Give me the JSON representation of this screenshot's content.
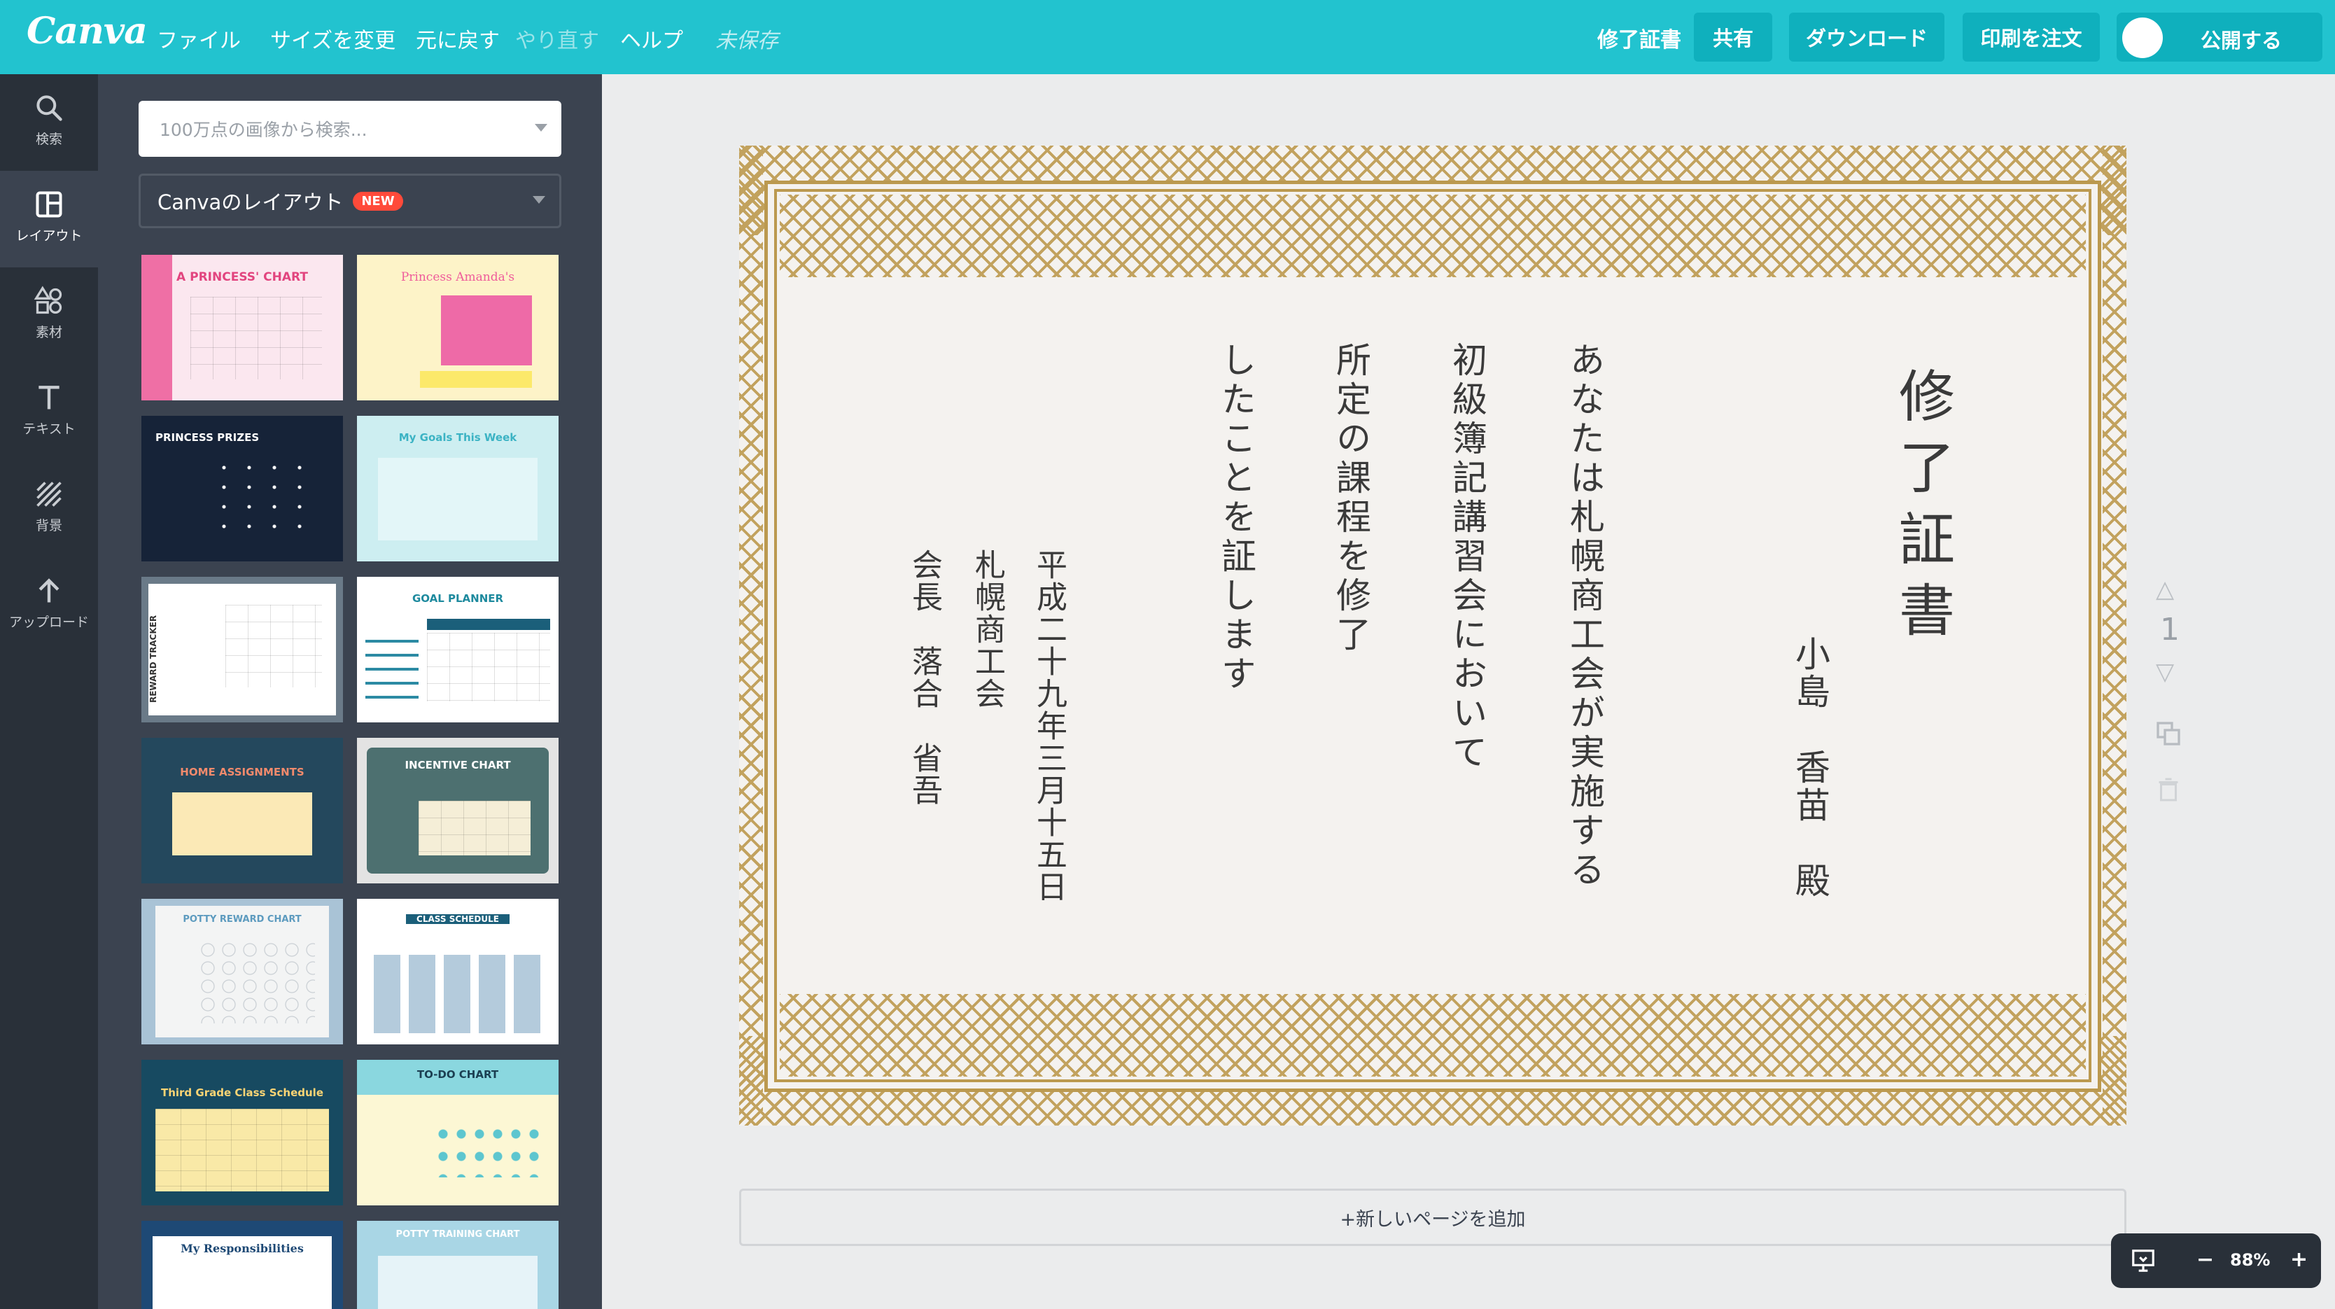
{
  "app": {
    "logo": "Canva"
  },
  "menu": {
    "file": "ファイル",
    "resize": "サイズを変更",
    "undo": "元に戻す",
    "redo": "やり直す",
    "help": "ヘルプ",
    "status": "未保存"
  },
  "toolbar": {
    "doc_title": "修了証書",
    "share": "共有",
    "download": "ダウンロード",
    "order_print": "印刷を注文",
    "publish": "公開する"
  },
  "rail": {
    "search": "検索",
    "layouts": "レイアウト",
    "elements": "素材",
    "text": "テキスト",
    "background": "背景",
    "upload": "アップロード"
  },
  "panel": {
    "search_placeholder": "100万点の画像から検索...",
    "layout_select": "Canvaのレイアウト",
    "new_badge": "NEW",
    "templates": [
      "A PRINCESS' CHART",
      "Princess Amanda's",
      "PRINCESS PRIZES",
      "My Goals This Week",
      "REWARD TRACKER",
      "GOAL PLANNER",
      "HOME ASSIGNMENTS",
      "INCENTIVE CHART",
      "POTTY REWARD CHART",
      "CLASS SCHEDULE",
      "Third Grade Class Schedule",
      "TO-DO CHART",
      "My Responsibilities",
      "POTTY TRAINING CHART"
    ]
  },
  "certificate": {
    "title": "修了証書",
    "recipient": "小島　香苗　殿",
    "body_lines": [
      "あなたは札幌商工会が実施する",
      "初級簿記講習会において",
      "所定の課程を修了",
      "したことを証します"
    ],
    "date": "平成二十九年三月十五日",
    "organization": "札幌商工会",
    "signatory": "会長　落合　省吾"
  },
  "page": {
    "number": "1",
    "add_page": "+新しいページを追加"
  },
  "zoom": {
    "minus": "−",
    "value": "88%",
    "plus": "+"
  },
  "colors": {
    "topbar": "#22c3cf",
    "rail": "#293039",
    "panel": "#3b4350",
    "gold": "#bb994f"
  }
}
